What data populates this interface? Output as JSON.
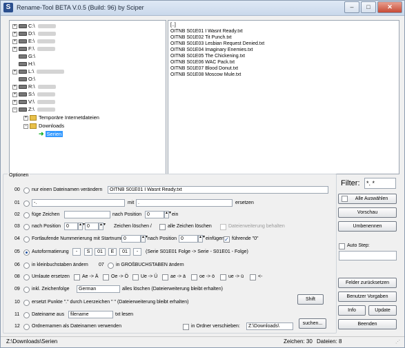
{
  "window": {
    "title": "Rename-Tool BETA V.0.5 (Build: 96) by Sciper",
    "minimize": "–",
    "maximize": "□",
    "close": "✕"
  },
  "tree": {
    "drives": [
      {
        "label": "C:\\",
        "expander": "+"
      },
      {
        "label": "D:\\",
        "expander": "+"
      },
      {
        "label": "E:\\",
        "expander": "+"
      },
      {
        "label": "F:\\",
        "expander": "+"
      },
      {
        "label": "G:\\",
        "expander": ""
      },
      {
        "label": "H:\\",
        "expander": ""
      },
      {
        "label": "L:\\",
        "expander": "+"
      },
      {
        "label": "O:\\",
        "expander": ""
      },
      {
        "label": "R:\\",
        "expander": "+"
      },
      {
        "label": "S:\\",
        "expander": "+"
      },
      {
        "label": "V:\\",
        "expander": "+"
      },
      {
        "label": "Z:\\",
        "expander": "−"
      }
    ],
    "folders": [
      {
        "label": "Temporäre Internetdateien",
        "expander": "+"
      },
      {
        "label": "Downloads",
        "expander": "−"
      }
    ],
    "selected": "Serien"
  },
  "files": [
    "[..]",
    "OITNB S01E01 I Wasnt Ready.txt",
    "OITNB S01E02 Tit Punch.txt",
    "OITNB S01E03 Lesbian Request Denied.txt",
    "OITNB S01E04 Imaginary Enemies.txt",
    "OITNB S01E05 The Chickening.txt",
    "OITNB S01E06 WAC Pack.txt",
    "OITNB S01E07 Blood Donut.txt",
    "OITNB S01E08 Moscow Mule.txt"
  ],
  "options": {
    "group_label": "Optionen",
    "r00": {
      "num": "00",
      "label": "nur einen Dateinamen verändern",
      "value": "OITNB S01E01 I Wasnt Ready.txt"
    },
    "r01": {
      "num": "01",
      "value1": "-.",
      "mit": "mit",
      "value2": ".",
      "suffix": "ersetzen"
    },
    "r02": {
      "num": "02",
      "label": "füge Zeichen",
      "value1": "",
      "pos_label": "nach Position",
      "pos": "0",
      "suffix": "ein"
    },
    "r03": {
      "num": "03",
      "label": "nach Position",
      "pos1": "0",
      "pos2": "0",
      "mid": "Zeichen löschen /",
      "all": "alle Zeichen löschen",
      "keep": "Dateierweiterung behalten"
    },
    "r04": {
      "num": "04",
      "label": "Fortlaufende Nummerierung mit Startnummer",
      "start": "0",
      "pos_label": "nach Position",
      "pos": "0",
      "insert": "einfügen",
      "leading": "führende \"0\""
    },
    "r05": {
      "num": "05",
      "label": "Autoformatierung",
      "f1": "-",
      "f2": "S",
      "f3": "01",
      "f4": "E",
      "f5": "01",
      "f6": "-",
      "hint": "(Serie S01E01 Folge -> Serie - S01E01 - Folge)"
    },
    "r06": {
      "num": "06",
      "label": "in kleinbuchstaben ändern",
      "num2": "07",
      "label2": "in GROßBUCHSTABEN ändern"
    },
    "r08": {
      "num": "08",
      "label": "Umlaute ersetzen",
      "u1": "Ae -> Ä",
      "u2": "Oe -> Ö",
      "u3": "Ue -> Ü",
      "u4": "ae -> ä",
      "u5": "oe -> ö",
      "u6": "ue -> ü",
      "u7": "<-"
    },
    "r09": {
      "num": "09",
      "label": "inkl. Zeichenfolge",
      "value": "German",
      "suffix": "alles löschen (Dateierweiterung bleibt erhalten)"
    },
    "r10": {
      "num": "10",
      "label": "ersetzt Punkte \".\" durch Leerzeichen \" \" (Dateierweiterung bleibt erhalten)",
      "shift": "Shift"
    },
    "r11": {
      "num": "11",
      "label": "Dateiname aus",
      "value": "filename",
      "suffix": "txt lesen"
    },
    "r12": {
      "num": "12",
      "label": "Ordnernamen als Dateinamen verwenden",
      "move": "in Ordner verschieben:",
      "path": "Z:\\Downloads\\",
      "search": "suchen..."
    }
  },
  "right": {
    "filter_label": "Filter:",
    "filter_value": "*. *",
    "select_all": "Alle Auswählen",
    "preview": "Vorschau",
    "rename": "Umbenennen",
    "autostep": "Auto Step:",
    "reset_folder": "Felder zurücksetzen",
    "user_prefs": "Benutzer Vorgaben",
    "info": "Info",
    "update": "Update",
    "quit": "Beenden"
  },
  "status": {
    "path": "Z:\\Downloads\\Serien",
    "chars": "Zeichen: 30",
    "files": "Dateien: 8"
  }
}
